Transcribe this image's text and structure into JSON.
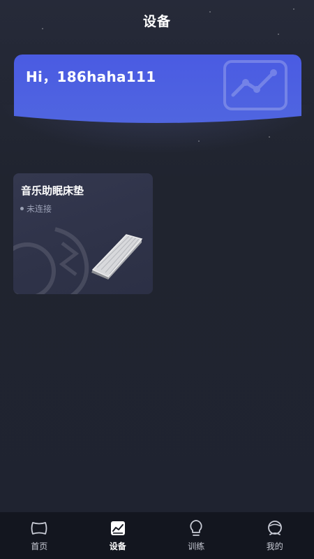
{
  "header": {
    "title": "设备"
  },
  "banner": {
    "greeting": "Hi，186haha111",
    "deco_icon": "chart-board-icon"
  },
  "devices": [
    {
      "name": "音乐助眠床垫",
      "status": "未连接",
      "image_icon": "mattress-icon"
    }
  ],
  "tabbar": {
    "items": [
      {
        "label": "首页",
        "icon": "home-icon",
        "active": false
      },
      {
        "label": "设备",
        "icon": "device-chart-icon",
        "active": true
      },
      {
        "label": "训练",
        "icon": "lightbulb-icon",
        "active": false
      },
      {
        "label": "我的",
        "icon": "profile-icon",
        "active": false
      }
    ]
  },
  "colors": {
    "background": "#1f2330",
    "banner": "#4b5ee0",
    "card": "#30344a",
    "tabbar": "#13161f",
    "status_text": "#9ba1b6"
  }
}
